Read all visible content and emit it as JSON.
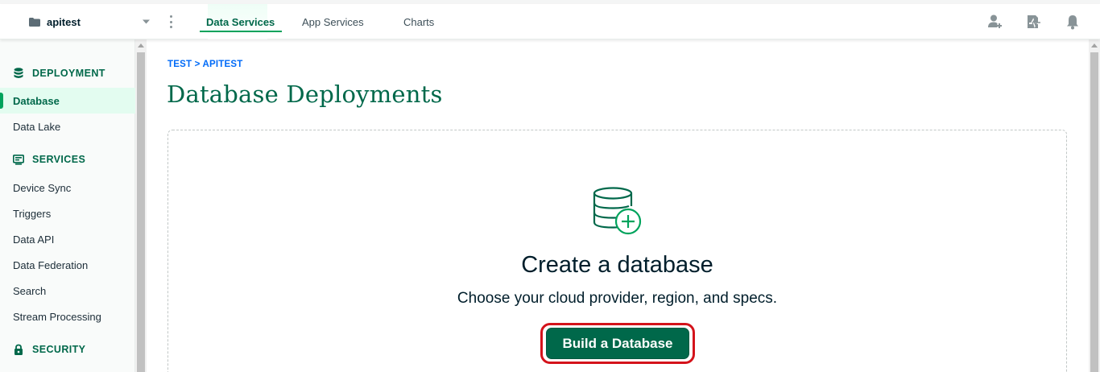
{
  "project": {
    "name": "apitest"
  },
  "nav": {
    "tabs": [
      {
        "label": "Data Services"
      },
      {
        "label": "App Services"
      },
      {
        "label": "Charts"
      }
    ]
  },
  "top_icons": [
    "person-add-icon",
    "activity-feed-icon",
    "bell-icon"
  ],
  "sidebar": {
    "sections": [
      {
        "label": "DEPLOYMENT",
        "icon": "database-stack-icon"
      },
      {
        "label": "SERVICES",
        "icon": "services-panel-icon"
      },
      {
        "label": "SECURITY",
        "icon": "lock-icon"
      }
    ],
    "items": [
      {
        "label": "Database",
        "active": true
      },
      {
        "label": "Data Lake"
      },
      {
        "label": "Device Sync"
      },
      {
        "label": "Triggers"
      },
      {
        "label": "Data API"
      },
      {
        "label": "Data Federation"
      },
      {
        "label": "Search"
      },
      {
        "label": "Stream Processing"
      }
    ]
  },
  "main": {
    "breadcrumb": "TEST > APITEST",
    "title": "Database Deployments",
    "empty_state": {
      "icon": "database-add-icon",
      "title": "Create a database",
      "subtitle": "Choose your cloud provider, region, and specs.",
      "button_label": "Build a Database"
    }
  },
  "colors": {
    "brand_green": "#00684a",
    "accent_green": "#00a35c",
    "link_blue": "#016bf8",
    "highlight_red": "#d4131b"
  }
}
